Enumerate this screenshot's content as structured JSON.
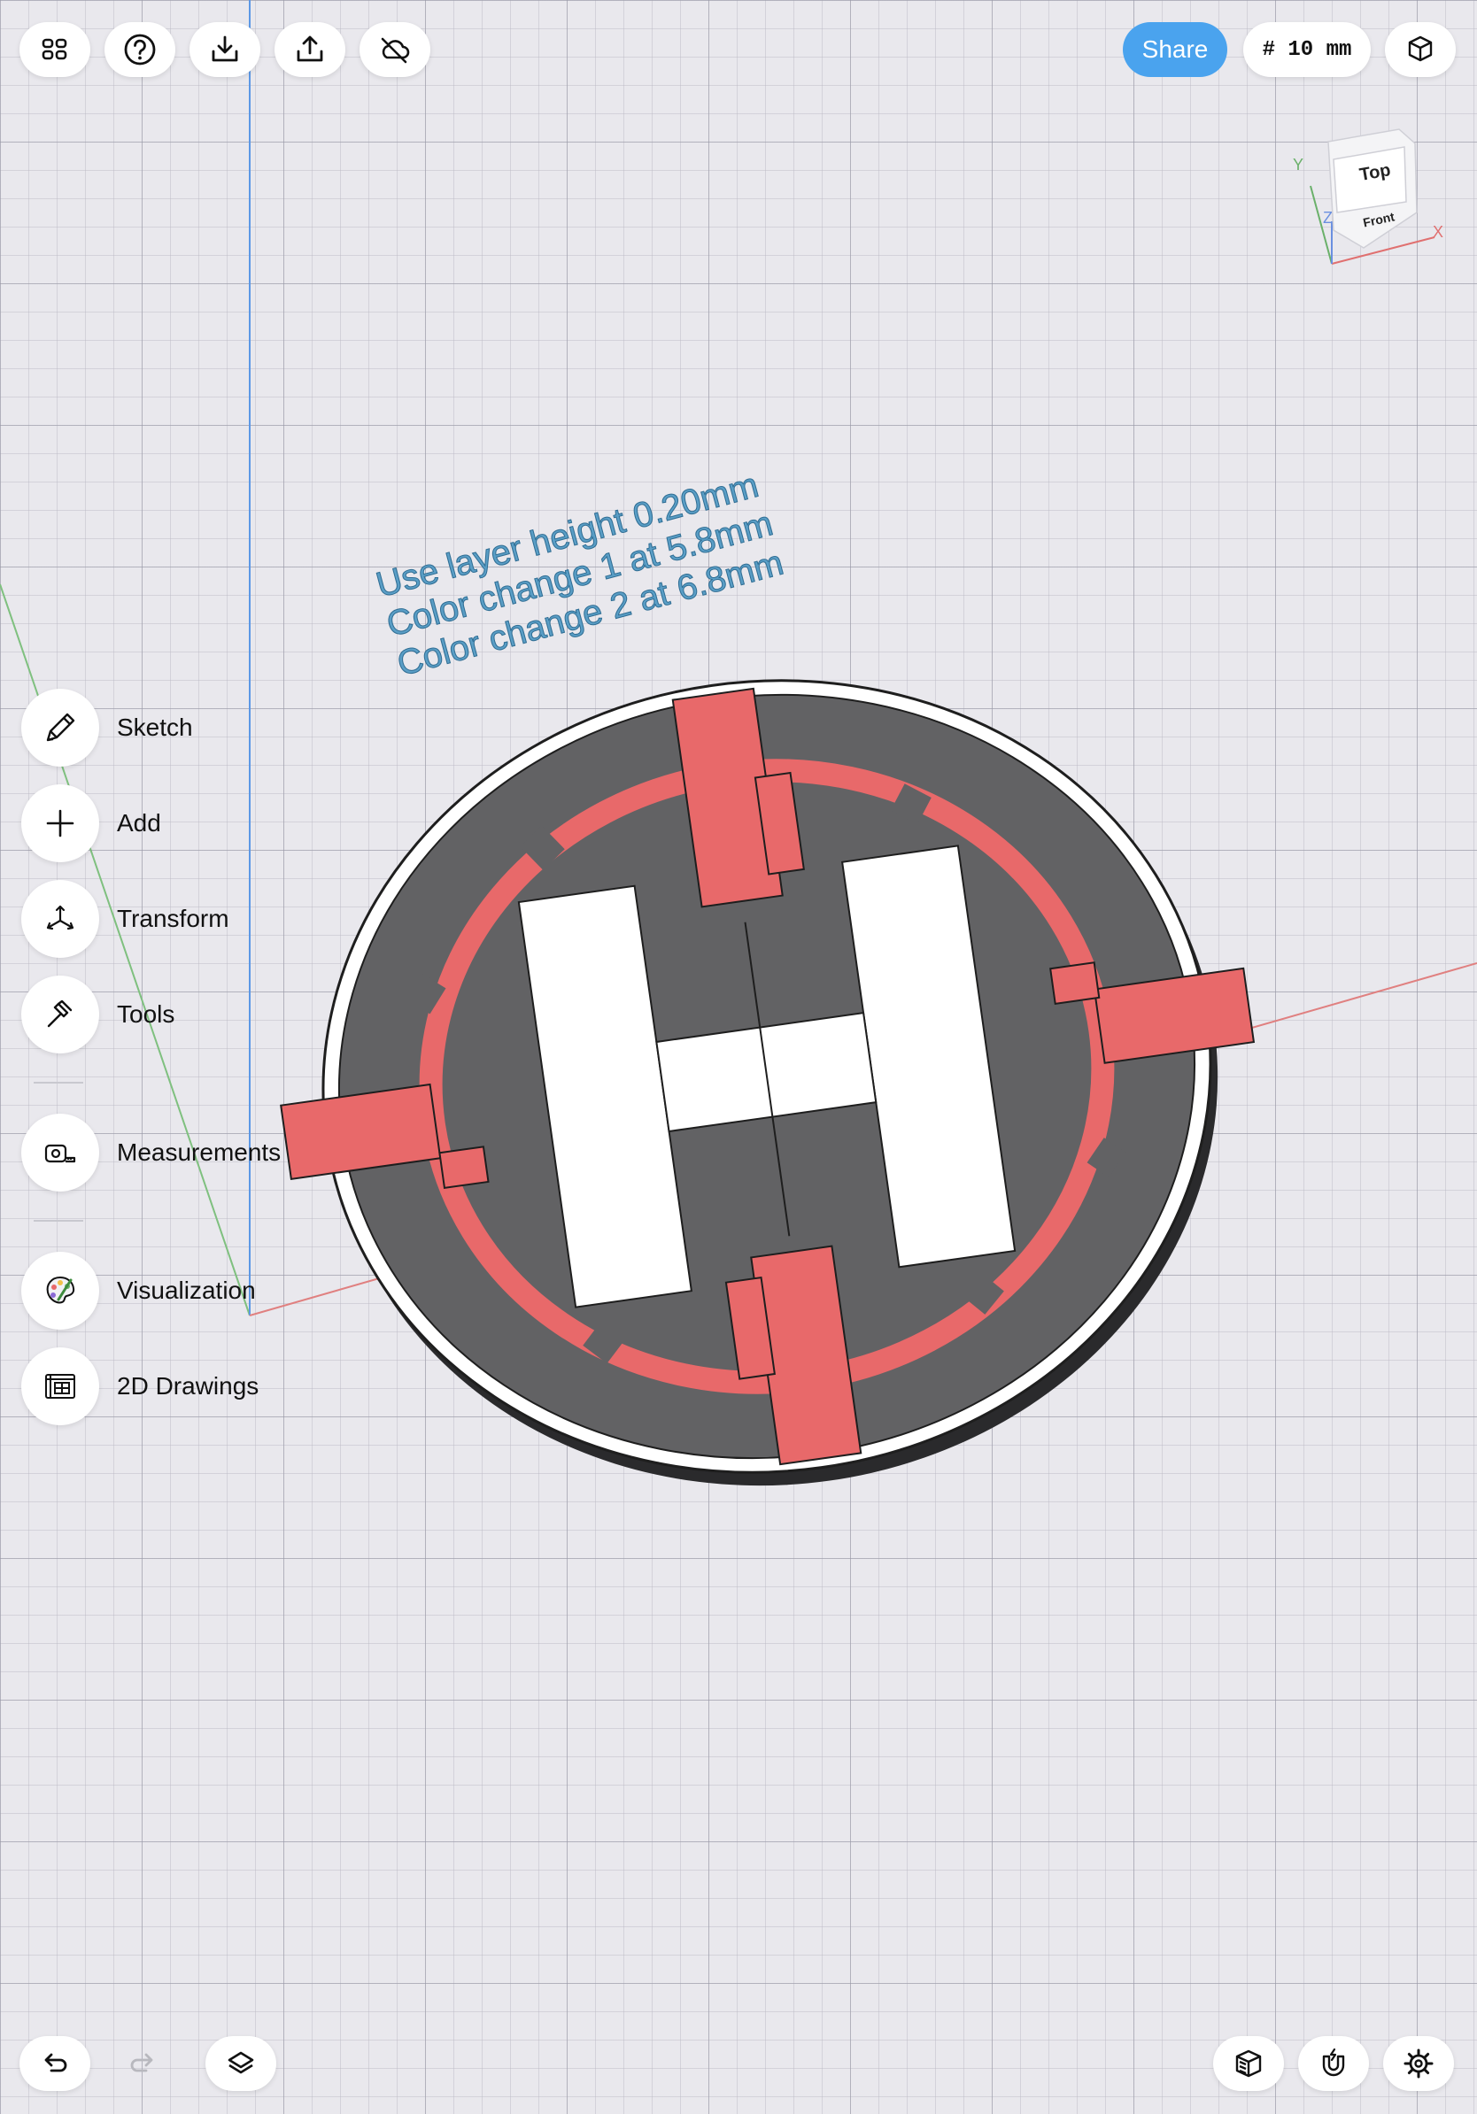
{
  "toolbar": {
    "left_icons": [
      "grid-view-icon",
      "help-icon",
      "import-icon",
      "export-icon",
      "cloud-icon"
    ],
    "share_label": "Share",
    "grid_size": "# 10 mm",
    "view_icon": "cube-view-icon"
  },
  "view_cube": {
    "top_label": "Top",
    "front_label": "Front",
    "axis_x": "X",
    "axis_y": "Y",
    "axis_z": "Z",
    "axis_colors": {
      "x": "#e07070",
      "y": "#6ab06a",
      "z": "#6a8fe0"
    }
  },
  "sidebar": {
    "groups": [
      [
        {
          "label": "Sketch",
          "icon": "pencil-icon"
        },
        {
          "label": "Add",
          "icon": "plus-icon"
        },
        {
          "label": "Transform",
          "icon": "move-arrows-icon"
        },
        {
          "label": "Tools",
          "icon": "hammer-icon"
        }
      ],
      [
        {
          "label": "Measurements",
          "icon": "tape-measure-icon"
        }
      ],
      [
        {
          "label": "Visualization",
          "icon": "palette-icon"
        },
        {
          "label": "2D Drawings",
          "icon": "blueprint-icon"
        }
      ]
    ]
  },
  "model": {
    "note_lines": [
      "Use layer height 0.20mm",
      "Color change 1 at 5.8mm",
      "Color change 2 at 6.8mm"
    ],
    "colors": {
      "base": "#ffffff",
      "disc": "#626264",
      "accent": "#e8696a",
      "letter": "#ffffff",
      "text": "#5a9ec6"
    }
  },
  "bottom_bar": {
    "left_icons": [
      "undo-icon",
      "redo-icon",
      "layers-icon"
    ],
    "right_icons": [
      "section-view-icon",
      "snap-magnet-icon",
      "settings-icon"
    ]
  }
}
